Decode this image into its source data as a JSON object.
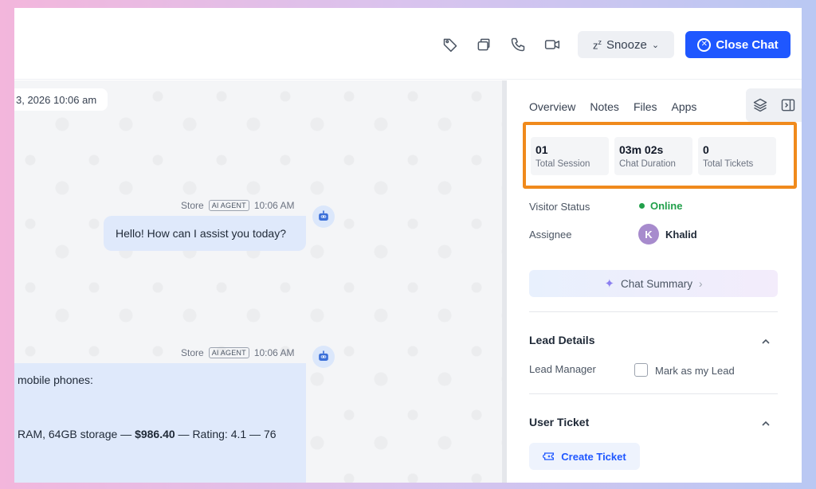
{
  "topbar": {
    "icons": [
      "tag-icon",
      "copy-icon",
      "phone-icon",
      "video-icon"
    ],
    "snooze_label": "Snooze",
    "close_label": "Close Chat"
  },
  "chat": {
    "date_pill": "3, 2026 10:06 am",
    "messages": [
      {
        "sender": "Store",
        "badge": "AI AGENT",
        "time": "10:06 AM",
        "text": "Hello! How can I assist you today?"
      },
      {
        "sender": "Store",
        "badge": "AI AGENT",
        "time": "10:06 AM",
        "line1": "mobile phones:",
        "line2_pre": "RAM, 64GB storage — ",
        "line2_price": "$986.40",
        "line2_post": " — Rating: 4.1 — 76"
      }
    ]
  },
  "panel": {
    "tabs": [
      {
        "label": "Overview"
      },
      {
        "label": "Notes"
      },
      {
        "label": "Files"
      },
      {
        "label": "Apps"
      }
    ],
    "stats": [
      {
        "value": "01",
        "label": "Total Session"
      },
      {
        "value": "03m 02s",
        "label": "Chat Duration"
      },
      {
        "value": "0",
        "label": "Total Tickets"
      }
    ],
    "visitor_status_label": "Visitor Status",
    "visitor_status_value": "Online",
    "assignee_label": "Assignee",
    "assignee_initial": "K",
    "assignee_name": "Khalid",
    "summary_label": "Chat Summary",
    "lead_details_title": "Lead Details",
    "lead_manager_label": "Lead Manager",
    "mark_lead_label": "Mark as my Lead",
    "user_ticket_title": "User Ticket",
    "create_ticket_label": "Create Ticket"
  },
  "colors": {
    "accent": "#1f57ff",
    "highlight": "#f08a1c",
    "online": "#22a04b"
  }
}
